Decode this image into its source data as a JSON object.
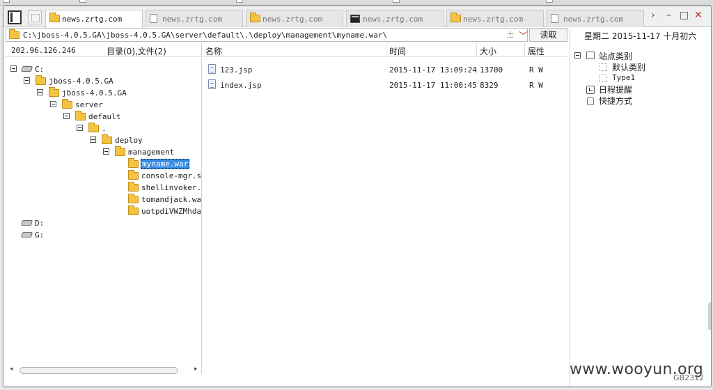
{
  "window_tabs": [
    {
      "label": "news.zrtg.com",
      "icon": "folder-icon",
      "active": true
    },
    {
      "label": "news.zrtg.com",
      "icon": "page-icon",
      "active": false
    },
    {
      "label": "news.zrtg.com",
      "icon": "folder-icon",
      "active": false
    },
    {
      "label": "news.zrtg.com",
      "icon": "terminal-icon",
      "active": false
    },
    {
      "label": "news.zrtg.com",
      "icon": "folder-icon",
      "active": false
    },
    {
      "label": "news.zrtg.com",
      "icon": "page-icon",
      "active": false
    }
  ],
  "window_controls": {
    "next": "›",
    "minimize": "–",
    "maximize": "□",
    "close": "✕"
  },
  "address": {
    "path": "C:\\jboss-4.0.5.GA\\jboss-4.0.5.GA\\server\\default\\.\\deploy\\management\\myname.war\\",
    "plus": "±",
    "dropdown": "﹀",
    "read_button": "读取"
  },
  "left_panel": {
    "ip": "202.96.126.246",
    "dir_info": "目录(0),文件(2)",
    "tree": [
      {
        "label": "C:",
        "type": "drive"
      },
      {
        "label": "jboss-4.0.5.GA",
        "type": "folder"
      },
      {
        "label": "jboss-4.0.5.GA",
        "type": "folder"
      },
      {
        "label": "server",
        "type": "folder"
      },
      {
        "label": "default",
        "type": "folder"
      },
      {
        "label": ".",
        "type": "folder"
      },
      {
        "label": "deploy",
        "type": "folder"
      },
      {
        "label": "management",
        "type": "folder"
      },
      {
        "label": "myname.war",
        "type": "folder",
        "selected": true
      },
      {
        "label": "console-mgr.sar",
        "type": "folder"
      },
      {
        "label": "shellinvoker.war",
        "type": "folder"
      },
      {
        "label": "tomandjack.war",
        "type": "folder"
      },
      {
        "label": "uotpdiVWZMhdar.war",
        "type": "folder"
      },
      {
        "label": "D:",
        "type": "drive"
      },
      {
        "label": "G:",
        "type": "drive"
      }
    ],
    "scroll_left": "◂",
    "scroll_right": "▸"
  },
  "file_list": {
    "columns": [
      "名称",
      "时间",
      "大小",
      "属性"
    ],
    "rows": [
      {
        "name": "123.jsp",
        "time": "2015-11-17 13:09:24",
        "size": "13700",
        "attr": "R W"
      },
      {
        "name": "index.jsp",
        "time": "2015-11-17 11:00:45",
        "size": "8329",
        "attr": "R W"
      }
    ]
  },
  "right_panel": {
    "date": "星期二 2015-11-17 十月初六",
    "items": [
      {
        "label": "站点类别"
      },
      {
        "label": "默认类别"
      },
      {
        "label": "Type1"
      },
      {
        "label": "日程提醒"
      },
      {
        "label": "快捷方式"
      }
    ]
  },
  "watermark": "www.wooyun.org",
  "encoding": "GB2312"
}
